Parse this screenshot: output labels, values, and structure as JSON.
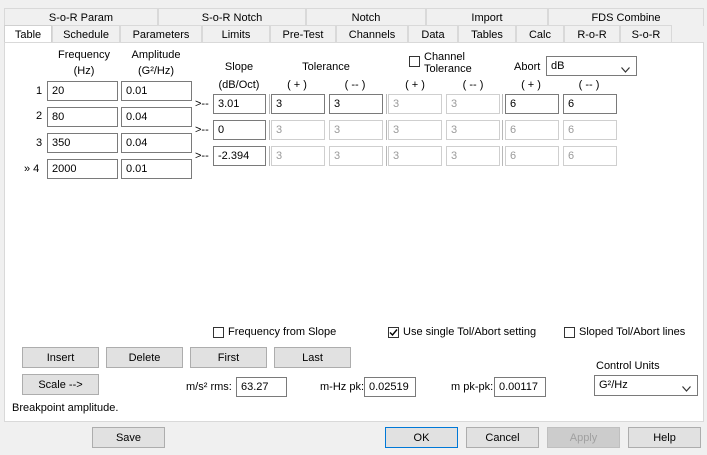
{
  "tabs_top": [
    "S-o-R Param",
    "S-o-R Notch",
    "Notch",
    "Import",
    "FDS Combine"
  ],
  "tabs_bottom": [
    "Table",
    "Schedule",
    "Parameters",
    "Limits",
    "Pre-Test",
    "Channels",
    "Data",
    "Tables",
    "Calc",
    "R-o-R",
    "S-o-R"
  ],
  "headers": {
    "frequency": "Frequency",
    "frequency_unit": "(Hz)",
    "amplitude": "Amplitude",
    "amplitude_unit": "(G²/Hz)",
    "slope": "Slope",
    "slope_unit": "(dB/Oct)",
    "tolerance": "Tolerance",
    "tol_plus": "( + )",
    "tol_minus": "( -- )",
    "channel_tolerance_line1": "Channel",
    "channel_tolerance_line2": "Tolerance",
    "ch_plus": "( + )",
    "ch_minus": "( -- )",
    "abort": "Abort",
    "abort_plus": "( + )",
    "abort_minus": "( -- )"
  },
  "abort_unit": "dB",
  "row_numbers": [
    "1",
    "2",
    "3",
    "» 4"
  ],
  "frequencies": [
    "20",
    "80",
    "350",
    "2000"
  ],
  "amplitudes": [
    "0.01",
    "0.04",
    "0.04",
    "0.01"
  ],
  "arrow_marker": ">--",
  "segments": [
    {
      "slope": "3.01",
      "tol_plus": "3",
      "tol_minus": "3",
      "ch_plus": "3",
      "ch_minus": "3",
      "abort_plus": "6",
      "abort_minus": "6"
    },
    {
      "slope": "0",
      "tol_plus": "3",
      "tol_minus": "3",
      "ch_plus": "3",
      "ch_minus": "3",
      "abort_plus": "6",
      "abort_minus": "6"
    },
    {
      "slope": "-2.394",
      "tol_plus": "3",
      "tol_minus": "3",
      "ch_plus": "3",
      "ch_minus": "3",
      "abort_plus": "6",
      "abort_minus": "6"
    }
  ],
  "options": {
    "frequency_from_slope": "Frequency from Slope",
    "single_tol": "Use single Tol/Abort setting",
    "sloped_tol": "Sloped Tol/Abort lines"
  },
  "buttons": {
    "insert": "Insert",
    "delete": "Delete",
    "first": "First",
    "last": "Last",
    "scale": "Scale -->",
    "save": "Save",
    "ok": "OK",
    "cancel": "Cancel",
    "apply": "Apply",
    "help": "Help"
  },
  "stats": {
    "rms_label": "m/s² rms:",
    "rms_value": "63.27",
    "pk_label": "m-Hz pk:",
    "pk_value": "0.02519",
    "pkpk_label": "m pk-pk:",
    "pkpk_value": "0.00117"
  },
  "control_units_label": "Control Units",
  "control_units_value": "G²/Hz",
  "status": "Breakpoint amplitude."
}
